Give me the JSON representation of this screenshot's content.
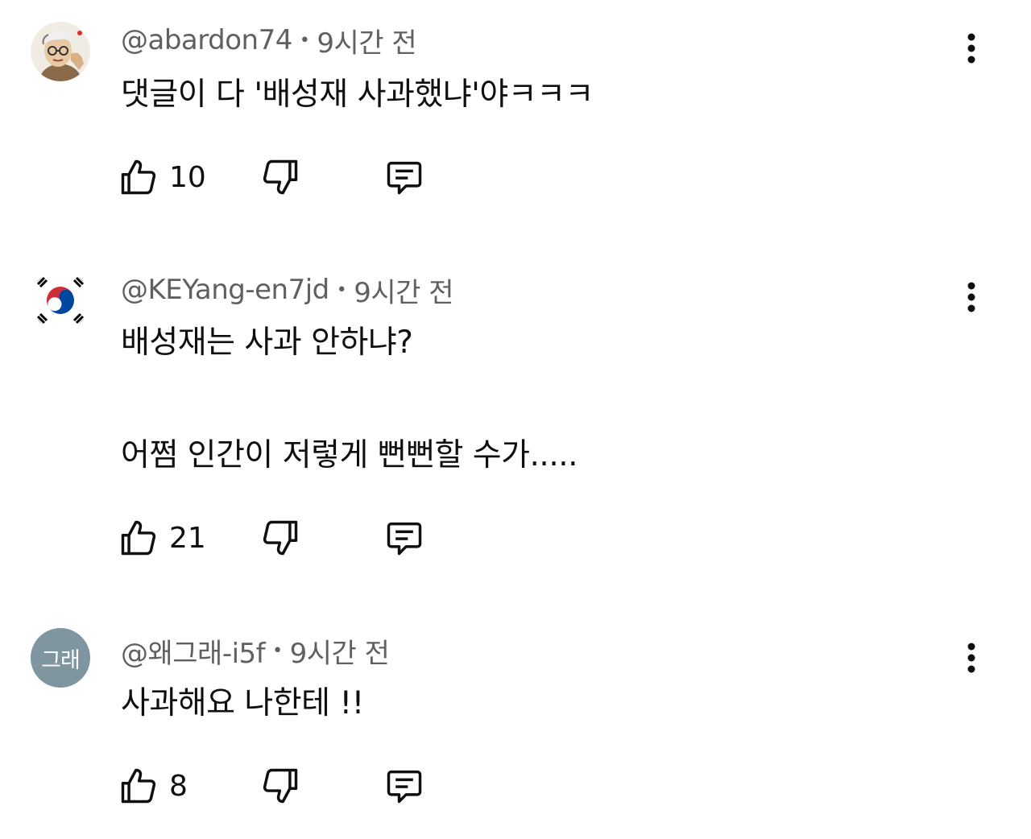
{
  "comments": [
    {
      "author": "@abardon74",
      "separator": "•",
      "time": "9시간 전",
      "avatar_type": "illustrated-portrait",
      "text_lines": [
        "댓글이 다 '배성재 사과했냐'야ㅋㅋㅋ"
      ],
      "likes": "10"
    },
    {
      "author": "@KEYang-en7jd",
      "separator": "•",
      "time": "9시간 전",
      "avatar_type": "korean-flag",
      "text_lines": [
        "배성재는 사과 안하냐?",
        "",
        "어쩜 인간이 저렇게 뻔뻔할 수가....."
      ],
      "likes": "21"
    },
    {
      "author": "@왜그래-i5f",
      "separator": "•",
      "time": "9시간 전",
      "avatar_type": "initials",
      "avatar_text": "그래",
      "avatar_color": "#7f95a0",
      "text_lines": [
        "사과해요 나한테 !!"
      ],
      "likes": "8"
    }
  ],
  "icons": {
    "like": "thumbs-up-icon",
    "dislike": "thumbs-down-icon",
    "reply": "reply-comment-icon",
    "more": "more-vertical-icon"
  }
}
